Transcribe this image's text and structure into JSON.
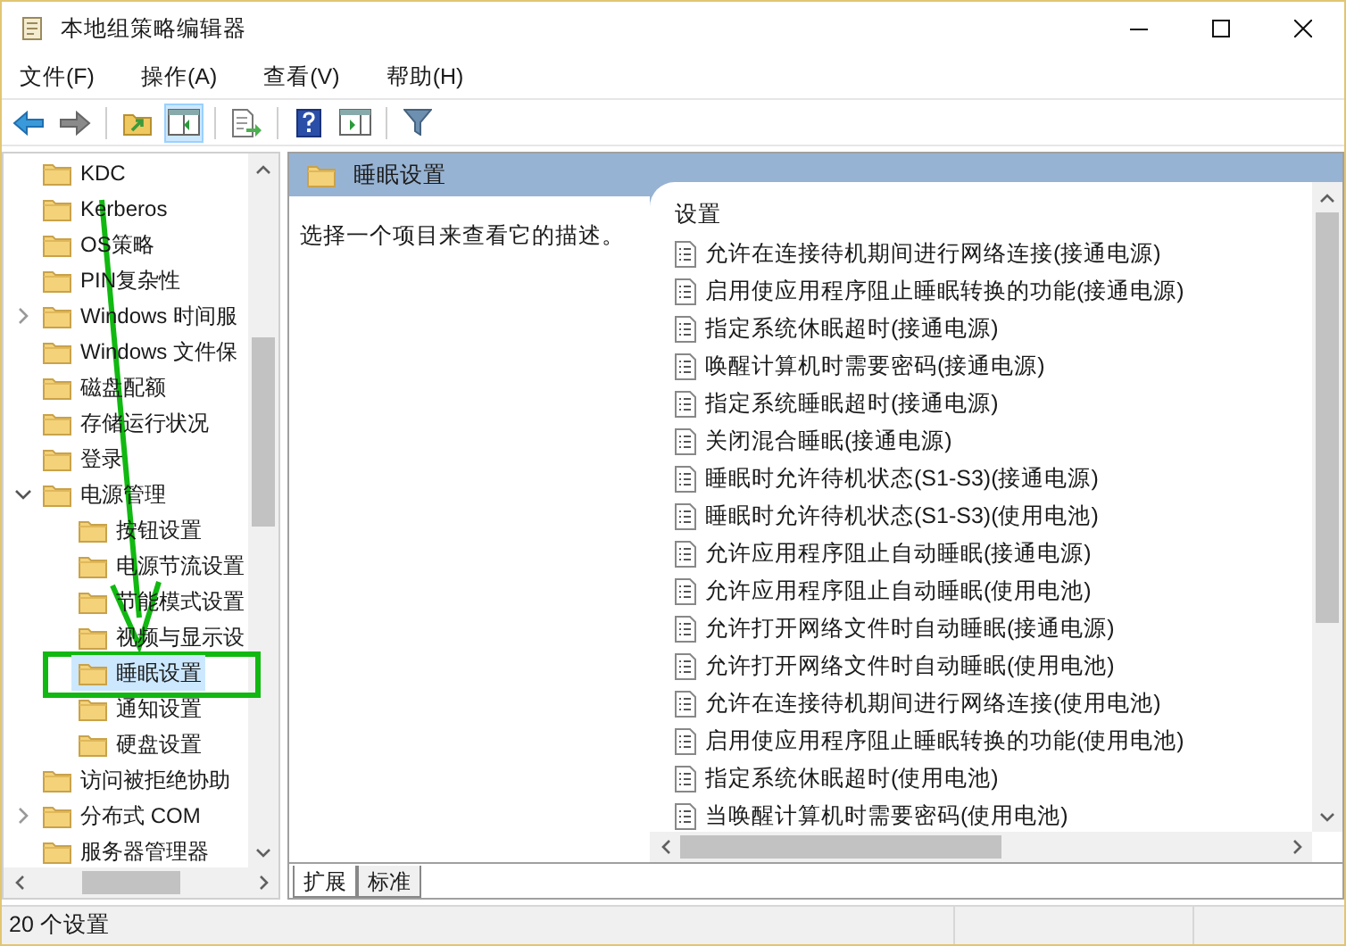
{
  "window": {
    "title": "本地组策略编辑器"
  },
  "menu": [
    "文件(F)",
    "操作(A)",
    "查看(V)",
    "帮助(H)"
  ],
  "toolbar": [
    {
      "kind": "back",
      "pressed": false
    },
    {
      "kind": "forward",
      "pressed": false
    },
    {
      "kind": "up",
      "pressed": false
    },
    {
      "kind": "tree",
      "pressed": true
    },
    {
      "kind": "export",
      "pressed": false
    },
    {
      "kind": "help",
      "pressed": false
    },
    {
      "kind": "pane",
      "pressed": false
    },
    {
      "kind": "filter",
      "pressed": false
    }
  ],
  "tree": [
    {
      "label": "KDC",
      "selected": false
    },
    {
      "label": "Kerberos",
      "selected": false
    },
    {
      "label": "OS策略",
      "selected": false
    },
    {
      "label": "PIN复杂性",
      "selected": false
    },
    {
      "label": "Windows 时间服",
      "selected": false,
      "expandable": true,
      "expanded": false
    },
    {
      "label": "Windows 文件保",
      "selected": false
    },
    {
      "label": "磁盘配额",
      "selected": false
    },
    {
      "label": "存储运行状况",
      "selected": false
    },
    {
      "label": "登录",
      "selected": false
    },
    {
      "label": "电源管理",
      "selected": false,
      "expandable": true,
      "expanded": true,
      "children": [
        {
          "label": "按钮设置",
          "selected": false
        },
        {
          "label": "电源节流设置",
          "selected": false
        },
        {
          "label": "节能模式设置",
          "selected": false
        },
        {
          "label": "视频与显示设",
          "selected": false
        },
        {
          "label": "睡眠设置",
          "selected": true
        },
        {
          "label": "通知设置",
          "selected": false
        },
        {
          "label": "硬盘设置",
          "selected": false
        }
      ]
    },
    {
      "label": "访问被拒绝协助",
      "selected": false
    },
    {
      "label": "分布式 COM",
      "selected": false,
      "expandable": true,
      "expanded": false
    },
    {
      "label": "服务器管理器",
      "selected": false
    }
  ],
  "details": {
    "heading": "睡眠设置",
    "description": "选择一个项目来查看它的描述。",
    "column": "设置",
    "settings": [
      "允许在连接待机期间进行网络连接(接通电源)",
      "启用使应用程序阻止睡眠转换的功能(接通电源)",
      "指定系统休眠超时(接通电源)",
      "唤醒计算机时需要密码(接通电源)",
      "指定系统睡眠超时(接通电源)",
      "关闭混合睡眠(接通电源)",
      "睡眠时允许待机状态(S1-S3)(接通电源)",
      "睡眠时允许待机状态(S1-S3)(使用电池)",
      "允许应用程序阻止自动睡眠(接通电源)",
      "允许应用程序阻止自动睡眠(使用电池)",
      "允许打开网络文件时自动睡眠(接通电源)",
      "允许打开网络文件时自动睡眠(使用电池)",
      "允许在连接待机期间进行网络连接(使用电池)",
      "启用使应用程序阻止睡眠转换的功能(使用电池)",
      "指定系统休眠超时(使用电池)",
      "当唤醒计算机时需要密码(使用电池)"
    ]
  },
  "view_tabs": [
    {
      "label": "扩展",
      "selected": true
    },
    {
      "label": "标准",
      "selected": false
    }
  ],
  "status_bar": "20 个设置"
}
